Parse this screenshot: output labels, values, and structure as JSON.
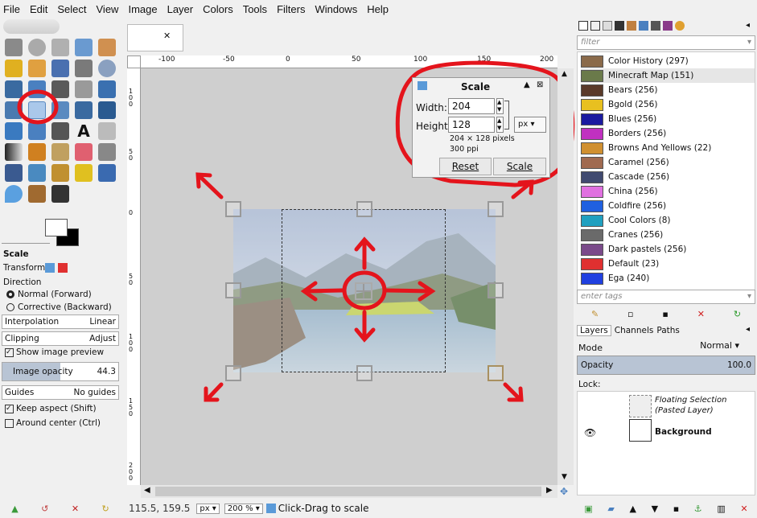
{
  "menu": [
    "File",
    "Edit",
    "Select",
    "View",
    "Image",
    "Layer",
    "Colors",
    "Tools",
    "Filters",
    "Windows",
    "Help"
  ],
  "tool_options": {
    "title": "Scale",
    "transform_label": "Transform:",
    "direction_label": "Direction",
    "direction_normal": "Normal (Forward)",
    "direction_corrective": "Corrective (Backward)",
    "interpolation_label": "Interpolation",
    "interpolation_value": "Linear",
    "clipping_label": "Clipping",
    "clipping_value": "Adjust",
    "show_preview": "Show image preview",
    "image_opacity_label": "Image opacity",
    "image_opacity_value": "44.3",
    "guides_label": "Guides",
    "guides_value": "No guides",
    "keep_aspect": "Keep aspect (Shift)",
    "around_center": "Around center (Ctrl)"
  },
  "ruler_top_labels": [
    "-100",
    "-50",
    "0",
    "50",
    "100",
    "150",
    "200"
  ],
  "ruler_left_labels": [
    "100",
    "50",
    "0",
    "50",
    "100",
    "150",
    "200"
  ],
  "scale_dialog": {
    "title": "Scale",
    "width_label": "Width:",
    "width_value": "204",
    "height_label": "Height:",
    "height_value": "128",
    "unit": "px",
    "size_info": "204 × 128 pixels",
    "resolution": "300 ppi",
    "reset_label": "Reset",
    "scale_label": "Scale"
  },
  "status": {
    "coords": "115.5, 159.5",
    "unit": "px",
    "zoom": "200 %",
    "message": "Click-Drag to scale"
  },
  "palettes": {
    "filter_placeholder": "filter",
    "tags_placeholder": "enter tags",
    "items": [
      {
        "name": "Color History (297)",
        "color": "#8a6a4a"
      },
      {
        "name": "Minecraft Map (151)",
        "color": "#6a7a4a"
      },
      {
        "name": "Bears (256)",
        "color": "#5a3a2a"
      },
      {
        "name": "Bgold (256)",
        "color": "#e8c020"
      },
      {
        "name": "Blues (256)",
        "color": "#1a1aa0"
      },
      {
        "name": "Borders (256)",
        "color": "#c030c0"
      },
      {
        "name": "Browns And Yellows (22)",
        "color": "#d09030"
      },
      {
        "name": "Caramel (256)",
        "color": "#a06a50"
      },
      {
        "name": "Cascade (256)",
        "color": "#404a70"
      },
      {
        "name": "China (256)",
        "color": "#e070e0"
      },
      {
        "name": "Coldfire (256)",
        "color": "#2060e0"
      },
      {
        "name": "Cool Colors (8)",
        "color": "#20a0c0"
      },
      {
        "name": "Cranes (256)",
        "color": "#6a6a6a"
      },
      {
        "name": "Dark pastels (256)",
        "color": "#7a4a8a"
      },
      {
        "name": "Default (23)",
        "color": "#e03030"
      },
      {
        "name": "Ega (240)",
        "color": "#2040e0"
      }
    ]
  },
  "layers": {
    "tabs": [
      "Layers",
      "Channels",
      "Paths"
    ],
    "mode_label": "Mode",
    "mode_value": "Normal",
    "opacity_label": "Opacity",
    "opacity_value": "100.0",
    "lock_label": "Lock:",
    "floating_line1": "Floating Selection",
    "floating_line2": "(Pasted Layer)",
    "background_name": "Background"
  }
}
